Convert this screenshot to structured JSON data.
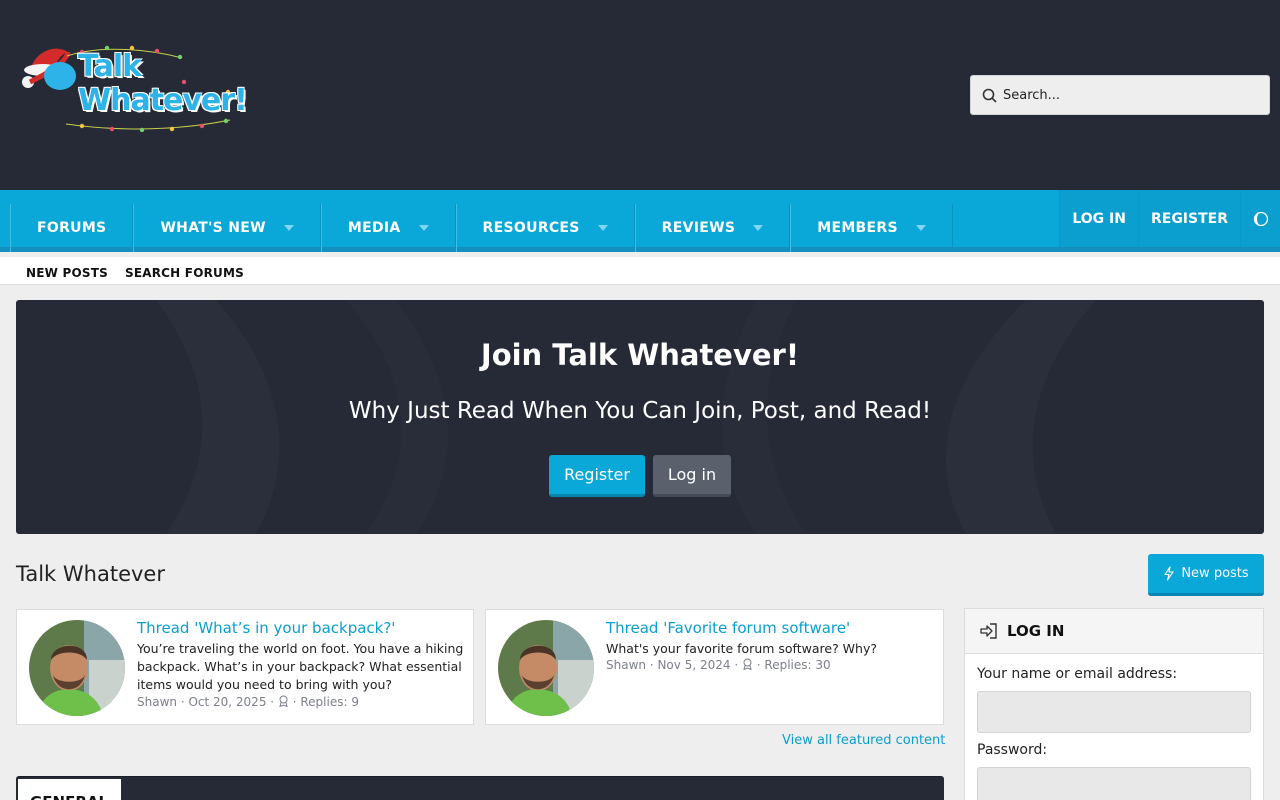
{
  "header": {
    "logo_line1": "Talk",
    "logo_line2": "Whatever!",
    "search_placeholder": "Search..."
  },
  "nav": {
    "tabs": [
      {
        "label": "FORUMS",
        "has_menu": false
      },
      {
        "label": "WHAT'S NEW",
        "has_menu": true
      },
      {
        "label": "MEDIA",
        "has_menu": true
      },
      {
        "label": "RESOURCES",
        "has_menu": true
      },
      {
        "label": "REVIEWS",
        "has_menu": true
      },
      {
        "label": "MEMBERS",
        "has_menu": true
      }
    ],
    "login_label": "LOG IN",
    "register_label": "REGISTER",
    "theme_icon": "style-variation-icon"
  },
  "subnav": {
    "new_posts": "NEW POSTS",
    "search_forums": "SEARCH FORUMS"
  },
  "banner": {
    "title": "Join Talk Whatever!",
    "subtitle": "Why Just Read When You Can Join, Post, and Read!",
    "register_button": "Register",
    "login_button": "Log in"
  },
  "main": {
    "title": "Talk Whatever",
    "new_posts_button": "New posts",
    "view_all": "View all featured content"
  },
  "featured": [
    {
      "title": "Thread 'What’s in your backpack?'",
      "snippet": "You’re traveling the world on foot. You have a hiking backpack. What’s in your backpack? What essential items would you need to bring with you?",
      "author": "Shawn",
      "date": "Oct 20, 2025",
      "replies": "Replies: 9"
    },
    {
      "title": "Thread 'Favorite forum software'",
      "snippet": "What's your favorite forum software? Why?",
      "author": "Shawn",
      "date": "Nov 5, 2024",
      "replies": "Replies: 30"
    }
  ],
  "forum": {
    "category_tab": "GENERAL"
  },
  "login_widget": {
    "heading": "LOG IN",
    "name_label": "Your name or email address:",
    "password_label": "Password:"
  },
  "colors": {
    "header_bg": "#252a36",
    "accent": "#0aa8d8",
    "link": "#0a9fd1"
  }
}
